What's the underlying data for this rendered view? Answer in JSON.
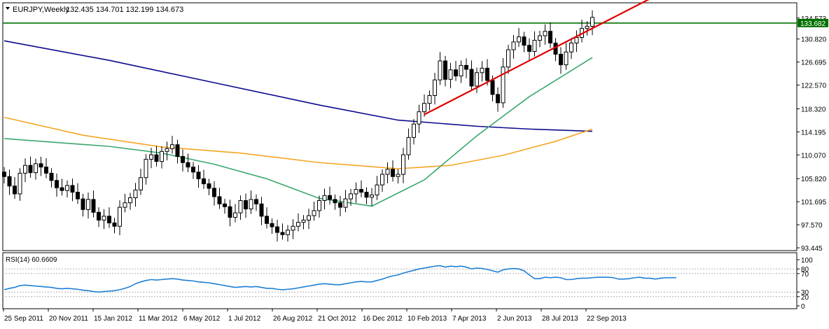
{
  "header": {
    "symbol": "EURJPY,Weekly",
    "ohlc": "132.435 134.701 132.199 134.673"
  },
  "rsi_panel": {
    "label": "RSI(14) 60.6609",
    "ticks": [
      "100",
      "80",
      "70",
      "30",
      "20",
      "0"
    ]
  },
  "price_marker": "133.682",
  "colors": {
    "background": "#ffffff",
    "frame": "#000000",
    "candle": "#000000",
    "ma_navy": "#0a0a8c",
    "ma_orange": "#f5a623",
    "ma_green": "#3aa76d",
    "trend_red": "#e00000",
    "support_green": "#007000",
    "rsi_line": "#1e7fd6",
    "marker_bg": "#007000"
  },
  "chart_data": [
    {
      "type": "candlestick",
      "title": "EURJPY,Weekly",
      "ylim": [
        93.445,
        136.3
      ],
      "ytick_labels": [
        "134.573",
        "130.820",
        "126.695",
        "122.570",
        "118.320",
        "114.195",
        "110.070",
        "105.820",
        "101.695",
        "97.570",
        "93.445"
      ],
      "xtick_labels": [
        "25 Sep 2011",
        "20 Nov 2011",
        "15 Jan 2012",
        "11 Mar 2012",
        "6 May 2012",
        "1 Jul 2012",
        "26 Aug 2012",
        "21 Oct 2012",
        "16 Dec 2012",
        "10 Feb 2013",
        "7 Apr 2013",
        "2 Jun 2013",
        "28 Jul 2013",
        "22 Sep 2013"
      ],
      "x_range": [
        0,
        112
      ],
      "close": [
        106.2,
        104.5,
        103.1,
        106.8,
        108.2,
        106.9,
        108.5,
        107.9,
        106.8,
        105.5,
        104.2,
        103.7,
        104.6,
        103.4,
        102.2,
        100.3,
        102.1,
        99.8,
        98.4,
        99.1,
        97.9,
        97.3,
        100.7,
        101.5,
        102.4,
        103.8,
        106.0,
        109.3,
        110.1,
        108.9,
        110.7,
        111.2,
        111.9,
        109.8,
        108.7,
        107.9,
        107.0,
        105.8,
        104.9,
        104.1,
        102.6,
        101.3,
        100.8,
        98.9,
        99.7,
        101.9,
        100.4,
        102.1,
        101.3,
        99.1,
        97.8,
        97.2,
        96.2,
        95.8,
        96.6,
        97.3,
        98.0,
        98.4,
        99.2,
        100.1,
        101.9,
        102.8,
        102.1,
        101.5,
        100.7,
        102.2,
        103.1,
        103.9,
        103.4,
        102.5,
        102.9,
        104.7,
        106.6,
        107.5,
        106.2,
        106.6,
        110.1,
        113.2,
        115.6,
        117.8,
        119.3,
        120.7,
        123.5,
        126.9,
        123.6,
        125.3,
        124.2,
        126.1,
        125.4,
        122.4,
        124.8,
        125.6,
        123.4,
        120.9,
        119.4,
        125.8,
        128.9,
        130.3,
        131.2,
        129.7,
        128.6,
        130.6,
        131.4,
        132.2,
        130.1,
        128.1,
        126.2,
        128.5,
        130.1,
        131.1,
        132.7,
        133.1,
        134.7
      ],
      "series": [
        {
          "name": "",
          "color": "#0a0a8c",
          "x": [
            0,
            20,
            40,
            60,
            75,
            90,
            100,
            112
          ],
          "values": [
            130.5,
            127.0,
            123.0,
            119.0,
            116.3,
            115.2,
            114.7,
            114.3
          ]
        },
        {
          "name": "",
          "color": "#f5a623",
          "x": [
            0,
            15,
            30,
            45,
            60,
            75,
            85,
            95,
            105,
            112
          ],
          "values": [
            116.8,
            113.6,
            111.5,
            110.4,
            108.7,
            107.6,
            108.2,
            110.0,
            112.5,
            114.7
          ]
        },
        {
          "name": "",
          "color": "#3aa76d",
          "x": [
            0,
            10,
            20,
            30,
            40,
            50,
            60,
            70,
            80,
            90,
            100,
            112
          ],
          "values": [
            113.0,
            112.3,
            111.6,
            110.4,
            108.4,
            105.8,
            102.3,
            100.9,
            105.6,
            113.5,
            120.5,
            127.5
          ]
        }
      ],
      "trendlines": [
        {
          "name": "",
          "color": "#e00000",
          "x": [
            80,
            125
          ],
          "values": [
            117.3,
            139.0
          ]
        },
        {
          "name": "",
          "color": "#007000",
          "x": [
            0,
            148
          ],
          "values": [
            133.682,
            133.682
          ]
        }
      ]
    },
    {
      "type": "line",
      "title": "RSI(14) 60.6609",
      "ylim": [
        0,
        100
      ],
      "ytick_labels": [
        "100",
        "80",
        "70",
        "30",
        "20",
        "0"
      ],
      "series": [
        {
          "name": "",
          "color": "#1e7fd6",
          "values": [
            35,
            38,
            40,
            44,
            45,
            44,
            43,
            42,
            41,
            40,
            38,
            37,
            38,
            37,
            36,
            34,
            33,
            31,
            30,
            31,
            32,
            33,
            35,
            38,
            42,
            48,
            52,
            55,
            57,
            56,
            57,
            58,
            59,
            58,
            56,
            55,
            54,
            52,
            51,
            50,
            48,
            46,
            44,
            42,
            40,
            41,
            42,
            41,
            42,
            40,
            38,
            38,
            36,
            35,
            36,
            37,
            39,
            41,
            43,
            45,
            47,
            48,
            47,
            46,
            46,
            48,
            50,
            52,
            53,
            52,
            52,
            55,
            58,
            62,
            65,
            67,
            71,
            74,
            77,
            80,
            82,
            84,
            86,
            87,
            84,
            86,
            85,
            86,
            84,
            80,
            82,
            81,
            79,
            76,
            73,
            78,
            80,
            81,
            80,
            76,
            67,
            59,
            59,
            62,
            61,
            62,
            61,
            57,
            57,
            59,
            60,
            60,
            61,
            62,
            62,
            62,
            61,
            58,
            58,
            59,
            61,
            62,
            60,
            60,
            58,
            60,
            61,
            61,
            61
          ]
        }
      ]
    }
  ]
}
